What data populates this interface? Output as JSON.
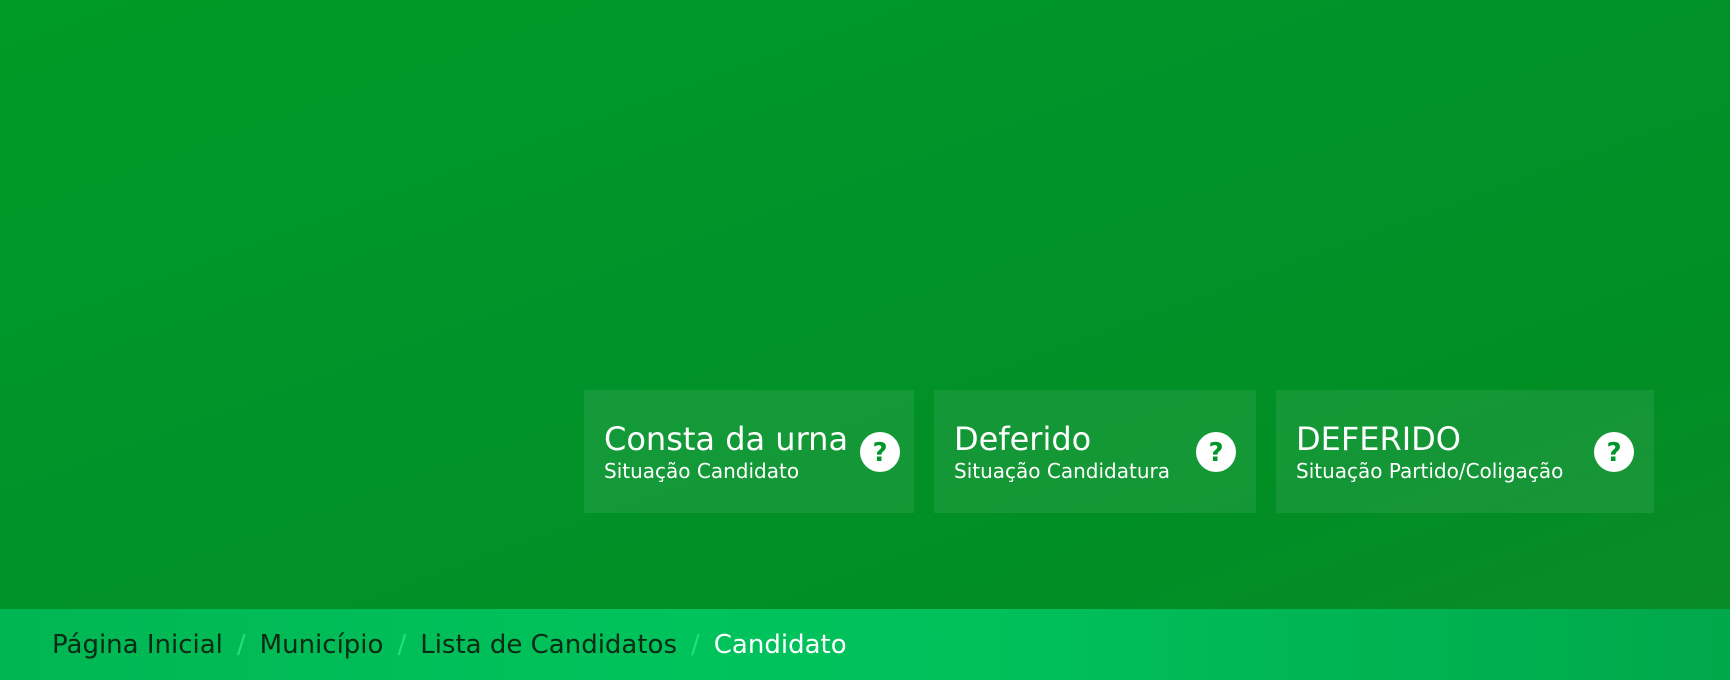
{
  "cards": [
    {
      "value": "Consta da urna",
      "label": "Situação Candidato",
      "icon": "question-circle-icon"
    },
    {
      "value": "Deferido",
      "label": "Situação Candidatura",
      "icon": "question-circle-icon"
    },
    {
      "value": "DEFERIDO",
      "label": "Situação Partido/Coligação",
      "icon": "question-circle-icon"
    }
  ],
  "breadcrumb": {
    "items": [
      "Página Inicial",
      "Município",
      "Lista de Candidatos"
    ],
    "current": "Candidato",
    "separator": "/"
  },
  "colors": {
    "background": "#00972a",
    "breadcrumb_bar": "#00c35c",
    "separator": "#22e07a",
    "card_text": "#ffffff"
  }
}
